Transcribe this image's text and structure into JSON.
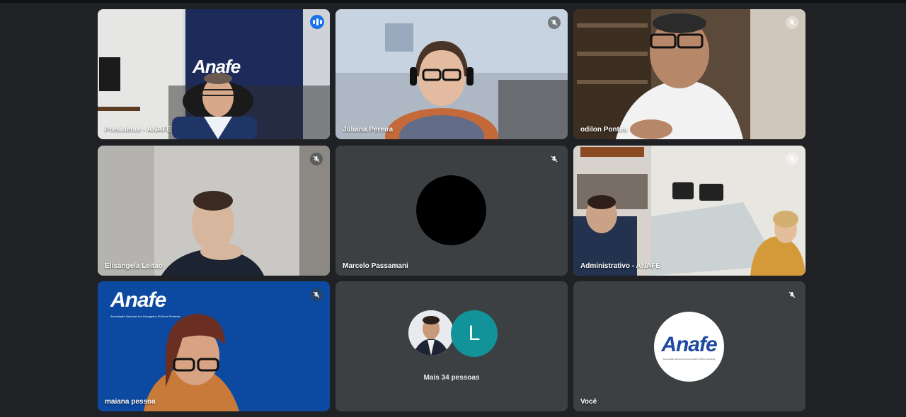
{
  "participants": [
    {
      "name": "Presidente - ANAFE",
      "speaking": true,
      "muted": false,
      "wall_logo": "Anafe"
    },
    {
      "name": "Juliana Pereira",
      "muted": true
    },
    {
      "name": "odilon Pontes",
      "muted": true
    },
    {
      "name": "Elisangela Leitao",
      "muted": true
    },
    {
      "name": "Marcelo Passamani",
      "muted": true
    },
    {
      "name": "Administrativo - ANAFE",
      "muted": true
    },
    {
      "name": "maiana pessoa",
      "muted": true,
      "banner_logo": "Anafe",
      "banner_subtitle": "Associação Nacional dos Advogados Públicos Federais"
    },
    {
      "summary": "Mais 34 pessoas",
      "avatar_letter": "L"
    },
    {
      "name": "Você",
      "muted": true,
      "logo": "Anafe",
      "logo_subtitle": "Associação Nacional dos Advogados Públicos Federais"
    }
  ],
  "icons": {
    "mic_off": "mic-off-icon",
    "speaking": "speaking-indicator-icon"
  },
  "colors": {
    "background": "#202124",
    "tile": "#3c4043",
    "active_border": "#8ab4f8",
    "speaking": "#1a73e8",
    "avatar_letter_bg": "#12939a"
  }
}
